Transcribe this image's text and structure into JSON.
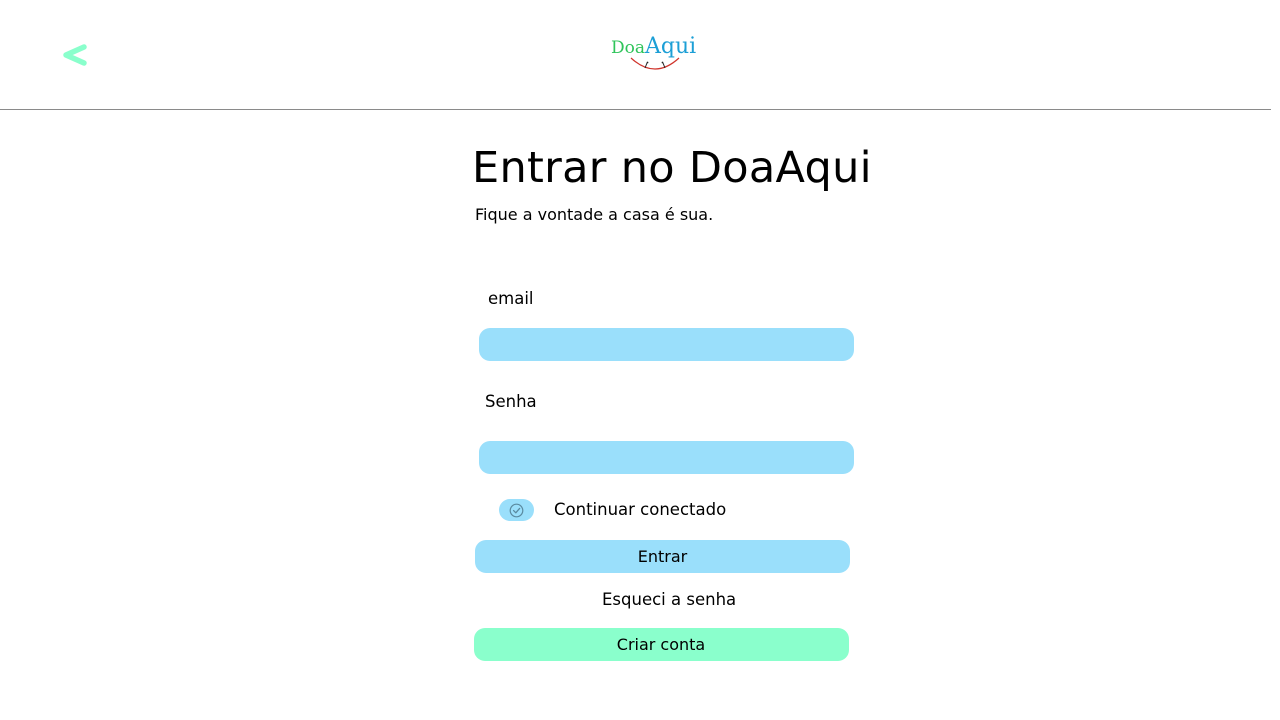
{
  "header": {
    "back_icon": "chevron-left-icon",
    "logo": {
      "part1": "Doa",
      "part2": "Aqui"
    }
  },
  "colors": {
    "accent_blue": "#9adffb",
    "accent_green": "#8affcc",
    "back_arrow": "#8affcc",
    "logo_green": "#2fc45a",
    "logo_blue": "#1c9fd6"
  },
  "login": {
    "title": "Entrar no DoaAqui",
    "subtitle": "Fique a vontade a casa é sua.",
    "email_label": "email",
    "email_value": "",
    "senha_label": "Senha",
    "senha_value": "",
    "remember_label": "Continuar conectado",
    "remember_icon": "check-circle-icon",
    "submit_label": "Entrar",
    "forgot_label": "Esqueci a senha",
    "create_label": "Criar conta"
  }
}
